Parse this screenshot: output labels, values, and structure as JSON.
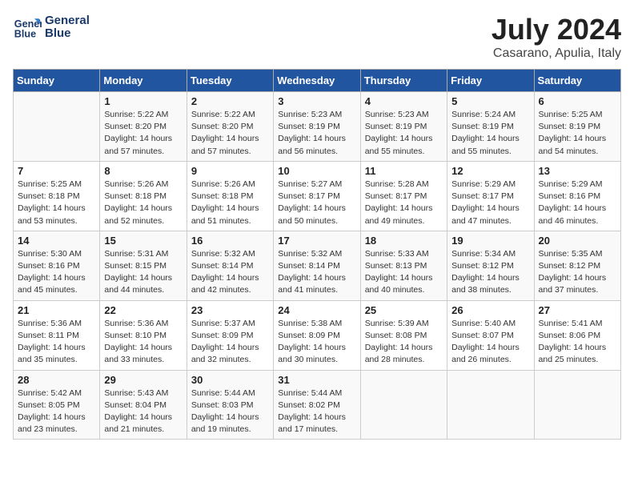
{
  "logo": {
    "line1": "General",
    "line2": "Blue"
  },
  "title": {
    "month_year": "July 2024",
    "location": "Casarano, Apulia, Italy"
  },
  "days_of_week": [
    "Sunday",
    "Monday",
    "Tuesday",
    "Wednesday",
    "Thursday",
    "Friday",
    "Saturday"
  ],
  "weeks": [
    [
      {
        "day": "",
        "info": ""
      },
      {
        "day": "1",
        "info": "Sunrise: 5:22 AM\nSunset: 8:20 PM\nDaylight: 14 hours\nand 57 minutes."
      },
      {
        "day": "2",
        "info": "Sunrise: 5:22 AM\nSunset: 8:20 PM\nDaylight: 14 hours\nand 57 minutes."
      },
      {
        "day": "3",
        "info": "Sunrise: 5:23 AM\nSunset: 8:19 PM\nDaylight: 14 hours\nand 56 minutes."
      },
      {
        "day": "4",
        "info": "Sunrise: 5:23 AM\nSunset: 8:19 PM\nDaylight: 14 hours\nand 55 minutes."
      },
      {
        "day": "5",
        "info": "Sunrise: 5:24 AM\nSunset: 8:19 PM\nDaylight: 14 hours\nand 55 minutes."
      },
      {
        "day": "6",
        "info": "Sunrise: 5:25 AM\nSunset: 8:19 PM\nDaylight: 14 hours\nand 54 minutes."
      }
    ],
    [
      {
        "day": "7",
        "info": "Sunrise: 5:25 AM\nSunset: 8:18 PM\nDaylight: 14 hours\nand 53 minutes."
      },
      {
        "day": "8",
        "info": "Sunrise: 5:26 AM\nSunset: 8:18 PM\nDaylight: 14 hours\nand 52 minutes."
      },
      {
        "day": "9",
        "info": "Sunrise: 5:26 AM\nSunset: 8:18 PM\nDaylight: 14 hours\nand 51 minutes."
      },
      {
        "day": "10",
        "info": "Sunrise: 5:27 AM\nSunset: 8:17 PM\nDaylight: 14 hours\nand 50 minutes."
      },
      {
        "day": "11",
        "info": "Sunrise: 5:28 AM\nSunset: 8:17 PM\nDaylight: 14 hours\nand 49 minutes."
      },
      {
        "day": "12",
        "info": "Sunrise: 5:29 AM\nSunset: 8:17 PM\nDaylight: 14 hours\nand 47 minutes."
      },
      {
        "day": "13",
        "info": "Sunrise: 5:29 AM\nSunset: 8:16 PM\nDaylight: 14 hours\nand 46 minutes."
      }
    ],
    [
      {
        "day": "14",
        "info": "Sunrise: 5:30 AM\nSunset: 8:16 PM\nDaylight: 14 hours\nand 45 minutes."
      },
      {
        "day": "15",
        "info": "Sunrise: 5:31 AM\nSunset: 8:15 PM\nDaylight: 14 hours\nand 44 minutes."
      },
      {
        "day": "16",
        "info": "Sunrise: 5:32 AM\nSunset: 8:14 PM\nDaylight: 14 hours\nand 42 minutes."
      },
      {
        "day": "17",
        "info": "Sunrise: 5:32 AM\nSunset: 8:14 PM\nDaylight: 14 hours\nand 41 minutes."
      },
      {
        "day": "18",
        "info": "Sunrise: 5:33 AM\nSunset: 8:13 PM\nDaylight: 14 hours\nand 40 minutes."
      },
      {
        "day": "19",
        "info": "Sunrise: 5:34 AM\nSunset: 8:12 PM\nDaylight: 14 hours\nand 38 minutes."
      },
      {
        "day": "20",
        "info": "Sunrise: 5:35 AM\nSunset: 8:12 PM\nDaylight: 14 hours\nand 37 minutes."
      }
    ],
    [
      {
        "day": "21",
        "info": "Sunrise: 5:36 AM\nSunset: 8:11 PM\nDaylight: 14 hours\nand 35 minutes."
      },
      {
        "day": "22",
        "info": "Sunrise: 5:36 AM\nSunset: 8:10 PM\nDaylight: 14 hours\nand 33 minutes."
      },
      {
        "day": "23",
        "info": "Sunrise: 5:37 AM\nSunset: 8:09 PM\nDaylight: 14 hours\nand 32 minutes."
      },
      {
        "day": "24",
        "info": "Sunrise: 5:38 AM\nSunset: 8:09 PM\nDaylight: 14 hours\nand 30 minutes."
      },
      {
        "day": "25",
        "info": "Sunrise: 5:39 AM\nSunset: 8:08 PM\nDaylight: 14 hours\nand 28 minutes."
      },
      {
        "day": "26",
        "info": "Sunrise: 5:40 AM\nSunset: 8:07 PM\nDaylight: 14 hours\nand 26 minutes."
      },
      {
        "day": "27",
        "info": "Sunrise: 5:41 AM\nSunset: 8:06 PM\nDaylight: 14 hours\nand 25 minutes."
      }
    ],
    [
      {
        "day": "28",
        "info": "Sunrise: 5:42 AM\nSunset: 8:05 PM\nDaylight: 14 hours\nand 23 minutes."
      },
      {
        "day": "29",
        "info": "Sunrise: 5:43 AM\nSunset: 8:04 PM\nDaylight: 14 hours\nand 21 minutes."
      },
      {
        "day": "30",
        "info": "Sunrise: 5:44 AM\nSunset: 8:03 PM\nDaylight: 14 hours\nand 19 minutes."
      },
      {
        "day": "31",
        "info": "Sunrise: 5:44 AM\nSunset: 8:02 PM\nDaylight: 14 hours\nand 17 minutes."
      },
      {
        "day": "",
        "info": ""
      },
      {
        "day": "",
        "info": ""
      },
      {
        "day": "",
        "info": ""
      }
    ]
  ]
}
